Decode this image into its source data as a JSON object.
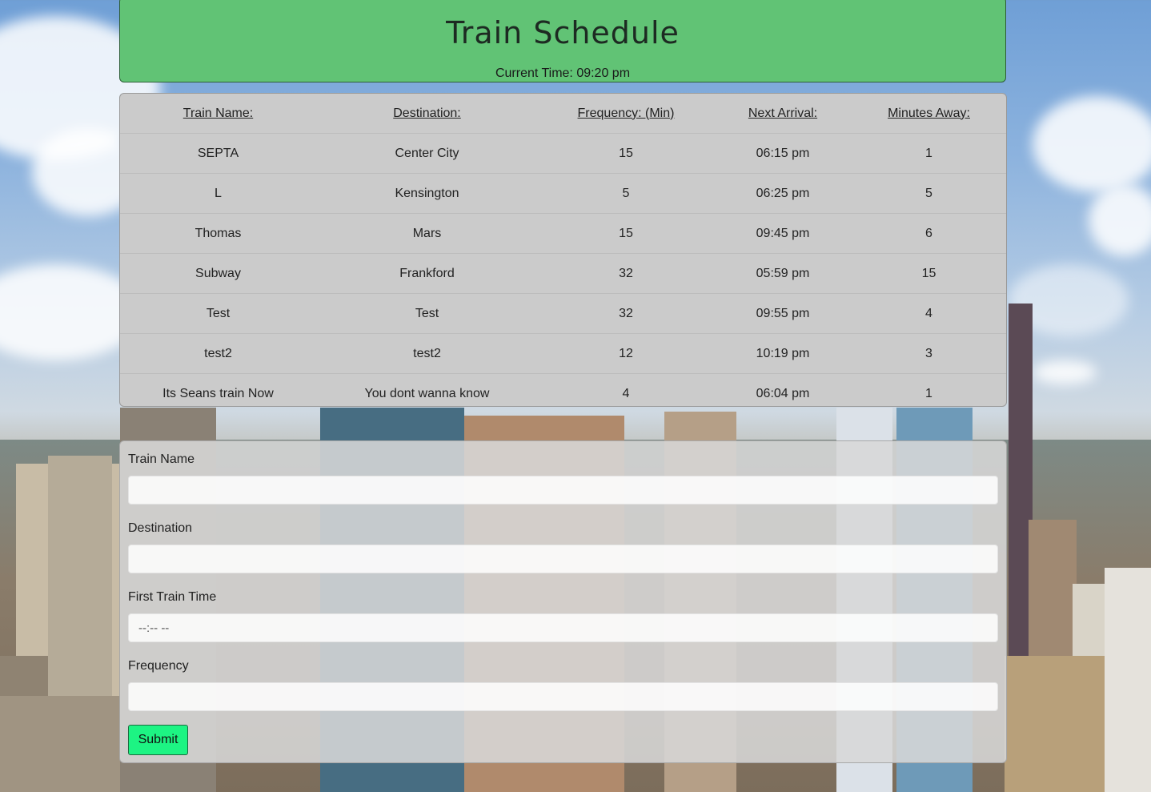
{
  "header": {
    "title": "Train Schedule",
    "current_time": "Current Time: 09:20 pm"
  },
  "table": {
    "columns": [
      "Train Name:",
      "Destination:",
      "Frequency: (Min)",
      "Next Arrival:",
      "Minutes Away:"
    ],
    "rows": [
      [
        "SEPTA",
        "Center City",
        "15",
        "06:15 pm",
        "1"
      ],
      [
        "L",
        "Kensington",
        "5",
        "06:25 pm",
        "5"
      ],
      [
        "Thomas",
        "Mars",
        "15",
        "09:45 pm",
        "6"
      ],
      [
        "Subway",
        "Frankford",
        "32",
        "05:59 pm",
        "15"
      ],
      [
        "Test",
        "Test",
        "32",
        "09:55 pm",
        "4"
      ],
      [
        "test2",
        "test2",
        "12",
        "10:19 pm",
        "3"
      ],
      [
        "Its Seans train Now",
        "You dont wanna know",
        "4",
        "06:04 pm",
        "1"
      ]
    ]
  },
  "form": {
    "train_name_label": "Train Name",
    "destination_label": "Destination",
    "first_train_time_label": "First Train Time",
    "first_train_time_placeholder": "--:-- --",
    "frequency_label": "Frequency",
    "submit_label": "Submit"
  },
  "colors": {
    "header_bg": "#61c375",
    "submit_bg": "#1df483"
  }
}
